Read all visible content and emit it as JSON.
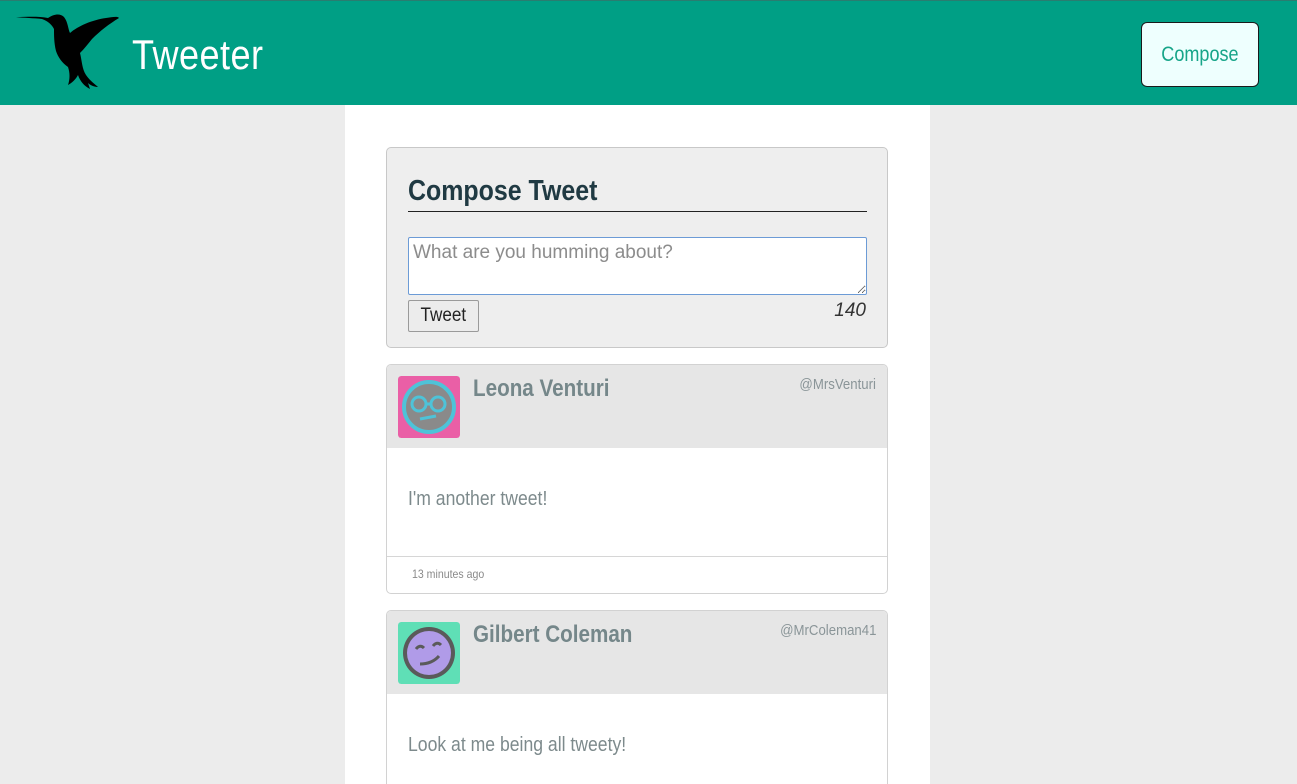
{
  "header": {
    "logo_icon": "hummingbird-icon",
    "brand": "Tweeter",
    "compose_label": "Compose"
  },
  "new_tweet": {
    "title": "Compose Tweet",
    "placeholder": "What are you humming about?",
    "submit_label": "Tweet",
    "counter": "140"
  },
  "tweets": [
    {
      "name": "Leona Venturi",
      "handle": "@MrsVenturi",
      "text": "I'm another tweet!",
      "time": "13 minutes ago",
      "avatar_bg": "#ea5fa6",
      "avatar_fg": "#4ec3d8"
    },
    {
      "name": "Gilbert Coleman",
      "handle": "@MrColeman41",
      "text": "Look at me being all tweety!",
      "time": "",
      "avatar_bg": "#5fdfb6",
      "avatar_fg": "#b09be8"
    }
  ],
  "colors": {
    "nav": "#009f85",
    "accent": "#17a589"
  }
}
